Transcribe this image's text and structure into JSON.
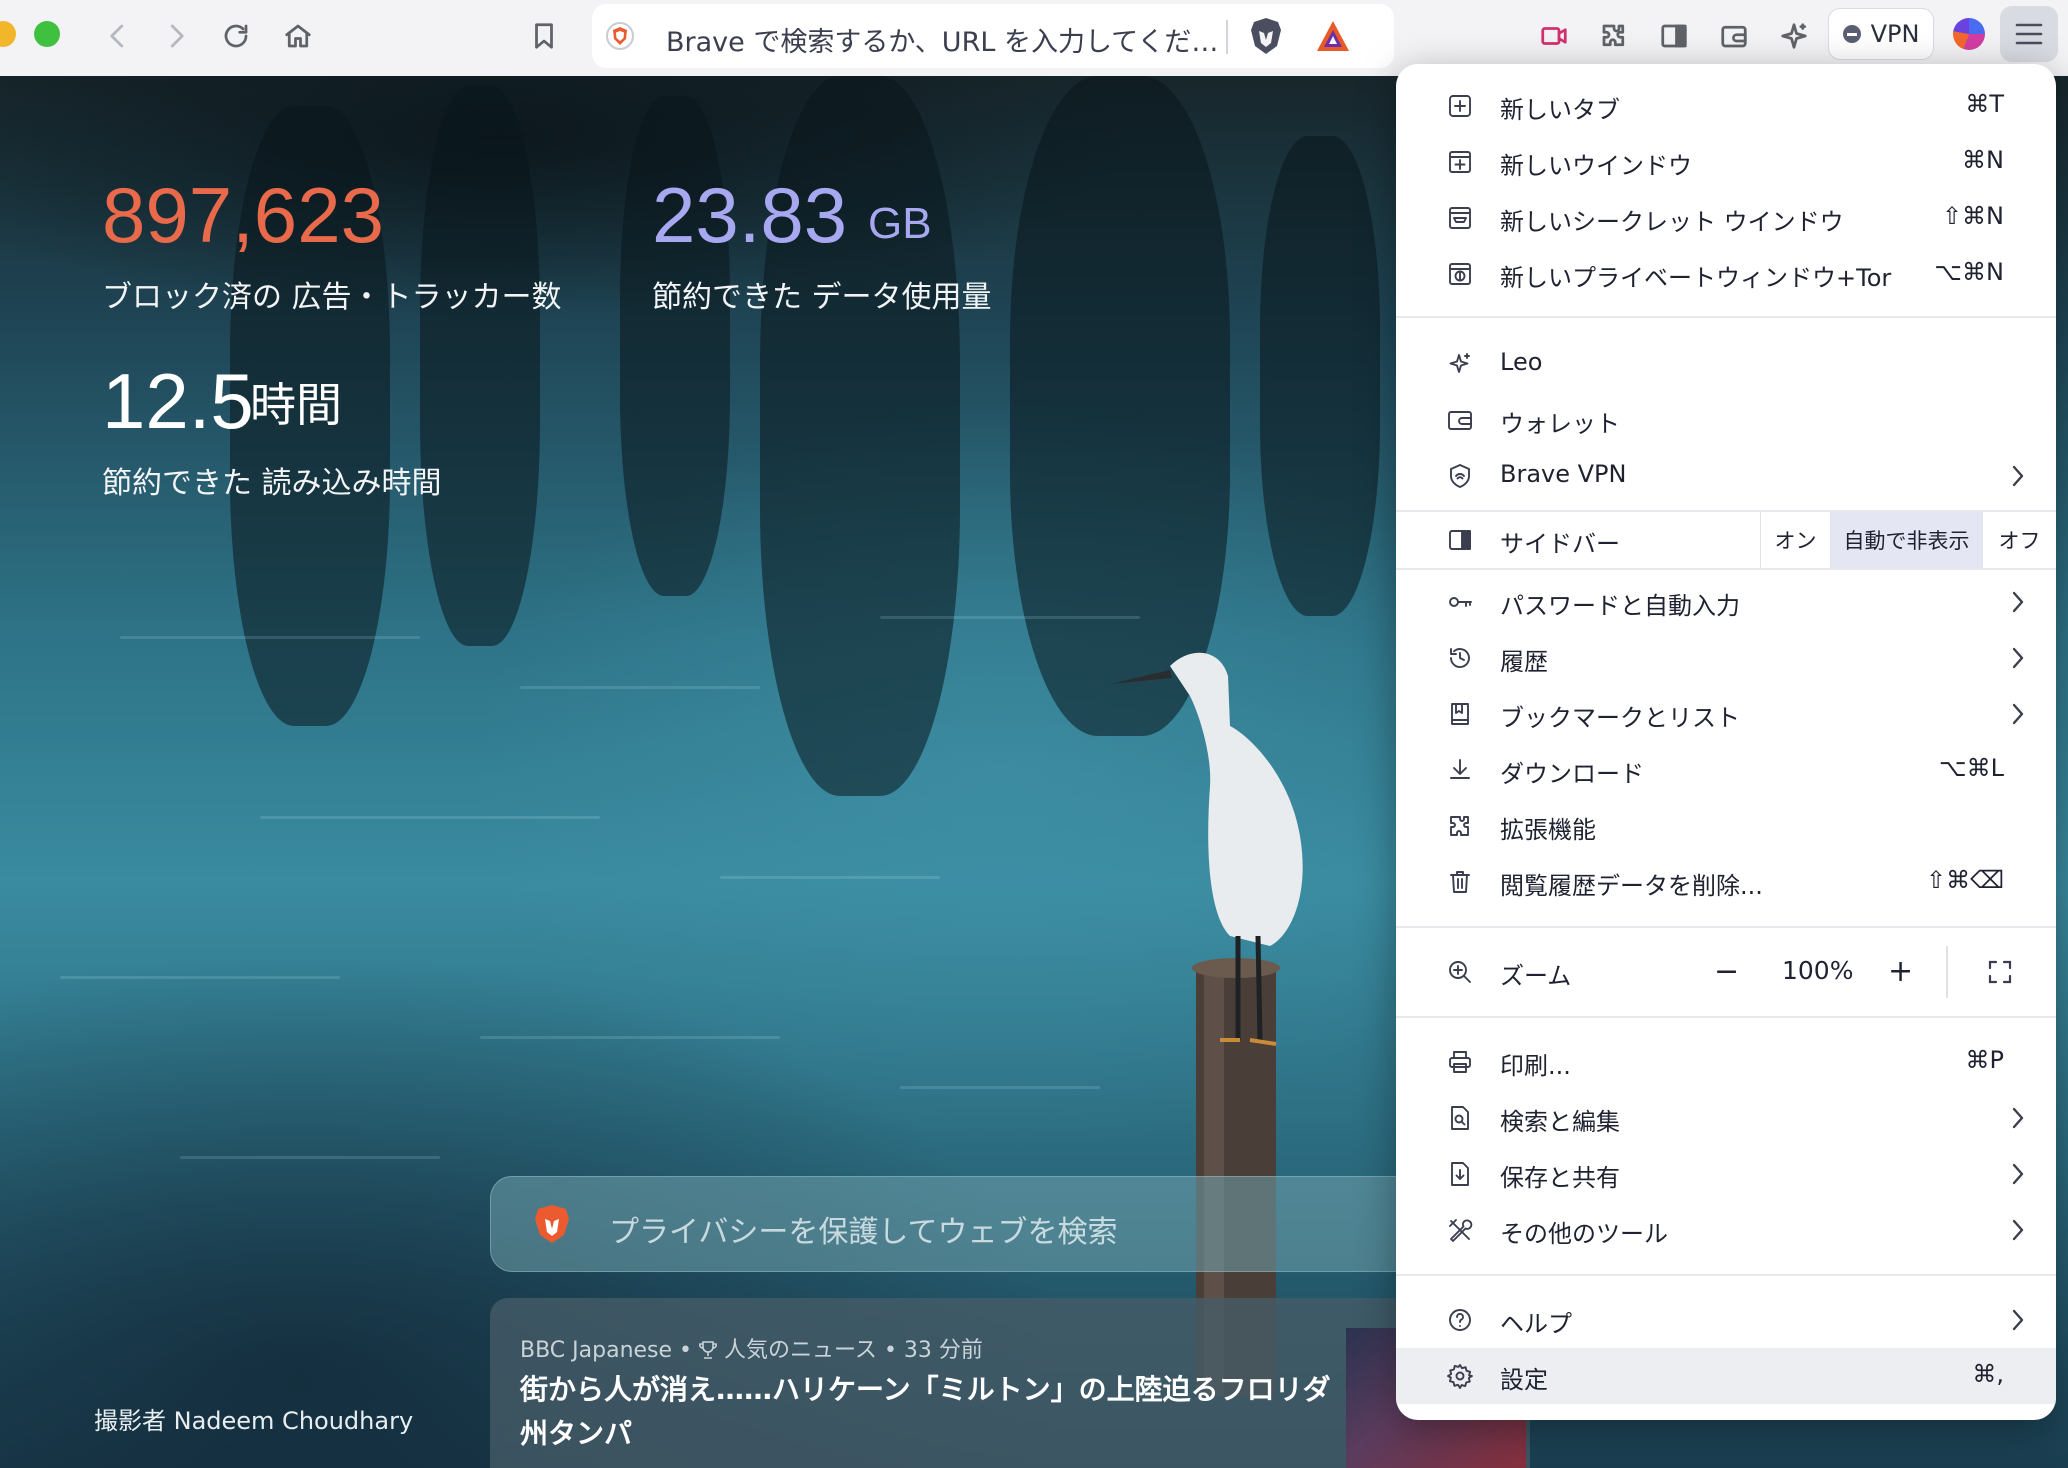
{
  "toolbar": {
    "url_placeholder": "Brave で検索するか、URL を入力してくだ…",
    "vpn_label": "VPN"
  },
  "stats": {
    "ads_value": "897,623",
    "ads_label": "ブロック済の 広告・トラッカー数",
    "data_value": "23.83",
    "data_unit": "GB",
    "data_label": "節約できた データ使用量",
    "time_value": "12.5",
    "time_unit": "時間",
    "time_label": "節約できた 読み込み時間"
  },
  "search": {
    "placeholder": "プライバシーを保護してウェブを検索"
  },
  "news": {
    "source": "BBC Japanese",
    "tag": "人気のニュース",
    "age": "33 分前",
    "title": "街から人が消え……ハリケーン「ミルトン」の上陸迫るフロリダ州タンパ"
  },
  "photo_credit": "撮影者 Nadeem Choudhary",
  "menu": {
    "new_tab": {
      "label": "新しいタブ",
      "shortcut": "⌘T"
    },
    "new_window": {
      "label": "新しいウインドウ",
      "shortcut": "⌘N"
    },
    "new_incognito": {
      "label": "新しいシークレット ウインドウ",
      "shortcut": "⇧⌘N"
    },
    "new_tor": {
      "label": "新しいプライベートウィンドウ+Tor",
      "shortcut": "⌥⌘N"
    },
    "leo": {
      "label": "Leo"
    },
    "wallet": {
      "label": "ウォレット"
    },
    "vpn": {
      "label": "Brave VPN"
    },
    "sidebar": {
      "label": "サイドバー",
      "options": [
        "オン",
        "自動で非表示",
        "オフ"
      ],
      "selected": "自動で非表示"
    },
    "passwords": {
      "label": "パスワードと自動入力"
    },
    "history": {
      "label": "履歴"
    },
    "bookmarks": {
      "label": "ブックマークとリスト"
    },
    "downloads": {
      "label": "ダウンロード",
      "shortcut": "⌥⌘L"
    },
    "extensions": {
      "label": "拡張機能"
    },
    "clear_data": {
      "label": "閲覧履歴データを削除...",
      "shortcut": "⇧⌘⌫"
    },
    "zoom": {
      "label": "ズーム",
      "minus": "−",
      "value": "100%",
      "plus": "+"
    },
    "print": {
      "label": "印刷...",
      "shortcut": "⌘P"
    },
    "find_edit": {
      "label": "検索と編集"
    },
    "save_share": {
      "label": "保存と共有"
    },
    "more_tools": {
      "label": "その他のツール"
    },
    "help": {
      "label": "ヘルプ"
    },
    "settings": {
      "label": "設定",
      "shortcut": "⌘,"
    }
  },
  "colors": {
    "ads_accent": "#e9694b",
    "data_accent": "#a7a8f0",
    "menu_bg": "#ffffff",
    "selected_bg": "#e4e6f4"
  }
}
